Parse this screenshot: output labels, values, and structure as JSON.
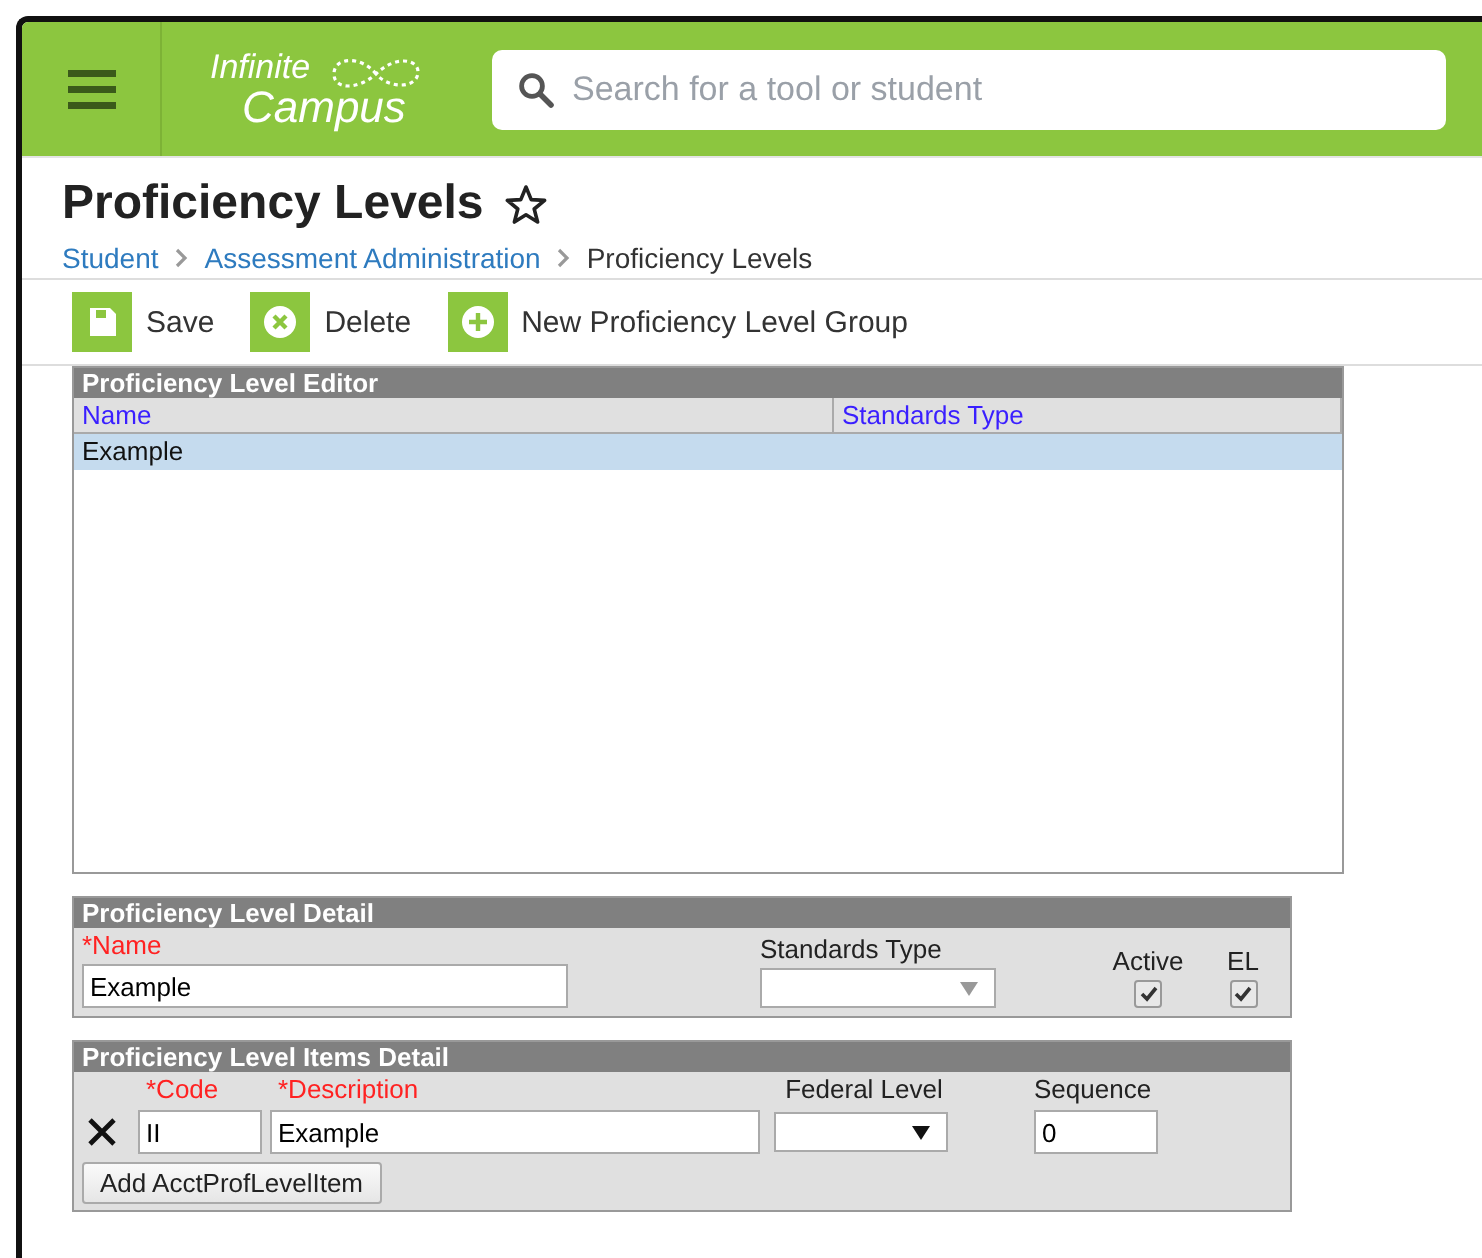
{
  "header": {
    "logo": {
      "line1": "Infinite",
      "line2": "Campus"
    },
    "search": {
      "placeholder": "Search for a tool or student"
    }
  },
  "page": {
    "title": "Proficiency Levels",
    "favorite": false,
    "breadcrumb": [
      {
        "label": "Student",
        "link": true
      },
      {
        "label": "Assessment Administration",
        "link": true
      },
      {
        "label": "Proficiency Levels",
        "link": false
      }
    ]
  },
  "toolbar": [
    {
      "label": "Save",
      "kind": "save"
    },
    {
      "label": "Delete",
      "kind": "delete"
    },
    {
      "label": "New Proficiency Level Group",
      "kind": "add"
    }
  ],
  "editor": {
    "title": "Proficiency Level Editor",
    "columns": [
      "Name",
      "Standards Type"
    ],
    "rows": [
      {
        "name": "Example",
        "selected": true
      }
    ]
  },
  "detail": {
    "title": "Proficiency Level Detail",
    "fields": [
      {
        "label": "*Name",
        "required": true,
        "kind": "text",
        "value": "Example"
      },
      {
        "label": "Standards Type",
        "required": false,
        "kind": "select",
        "disabled": true
      },
      {
        "label": "Active",
        "required": false,
        "kind": "checkbox",
        "checked": true
      },
      {
        "label": "EL",
        "required": false,
        "kind": "checkbox",
        "checked": true
      }
    ]
  },
  "items": {
    "title": "Proficiency Level Items Detail",
    "columns": [
      {
        "label": "*Code",
        "required": true
      },
      {
        "label": "*Description",
        "required": true
      },
      {
        "label": "Federal Level",
        "required": false
      },
      {
        "label": "Sequence",
        "required": false
      }
    ],
    "rows": [
      {
        "code": "II",
        "description": "Example",
        "sequence": "0"
      }
    ],
    "add_button": "Add AcctProfLevelItem"
  }
}
